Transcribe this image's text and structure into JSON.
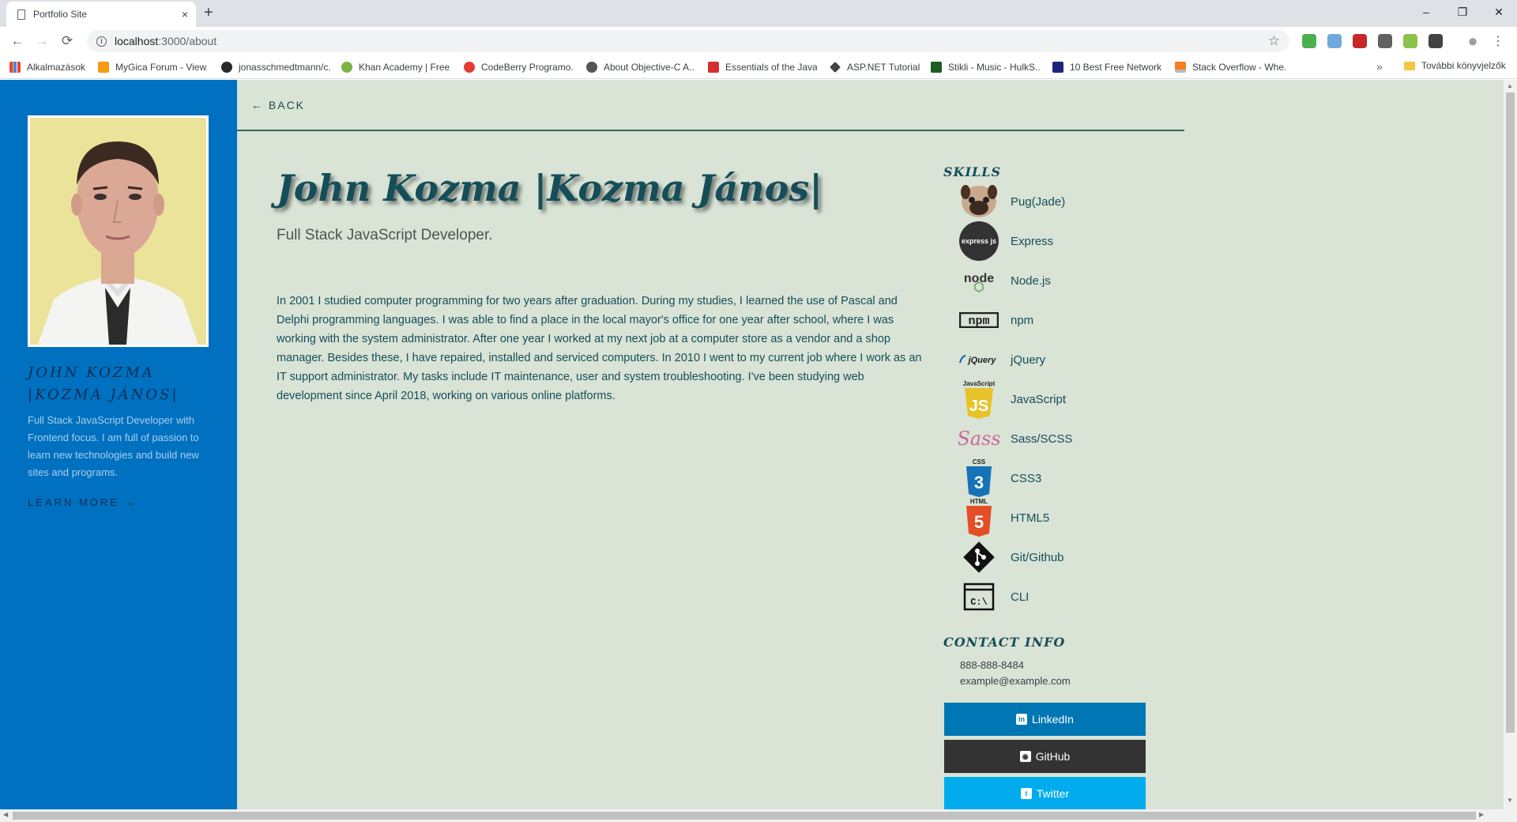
{
  "browser": {
    "tab_title": "Portfolio Site",
    "tab_close": "×",
    "new_tab": "+",
    "url_host": "localhost",
    "url_path": ":3000/about",
    "window_controls": [
      "–",
      "❐",
      "✕"
    ],
    "bookmarks": [
      "Alkalmazások",
      "MyGica Forum - View...",
      "jonasschmedtmann/c...",
      "Khan Academy | Free...",
      "CodeBerry Programo...",
      "About Objective-C A...",
      "Essentials of the Java...",
      "ASP.NET Tutorial",
      "Stikli - Music - HulkS...",
      "10 Best Free Network...",
      "Stack Overflow - Whe..."
    ],
    "bookmarks_more": "»",
    "other_bookmarks": "További könyvjelzők",
    "extension_colors": [
      "#4caf50",
      "#6fa8dc",
      "#c62828",
      "#616161",
      "#8bc34a",
      "#424242"
    ]
  },
  "sidebar": {
    "name": "JOHN KOZMA |KOZMA JÁNOS|",
    "description": "Full Stack JavaScript Developer with Frontend focus. I am full of passion to learn new technologies and build new sites and programs.",
    "learn_more": "LEARN MORE →"
  },
  "main": {
    "back": "← BACK",
    "heading": "John Kozma |Kozma János|",
    "subtitle": "Full Stack JavaScript Developer.",
    "bio": "In 2001 I studied computer programming for two years after graduation. During my studies, I learned the use of Pascal and Delphi programming languages. I was able to find a place in the local mayor's office for one year after school, where I was working with the system administrator. After one year I worked at my next job at a computer store as a vendor and a shop manager. Besides these, I have repaired, installed and serviced computers. In 2010 I went to my current job where I work as an IT support administrator. My tasks include IT maintenance, user and system troubleshooting. I've been studying web development since April 2018, working on various online platforms."
  },
  "skills": {
    "heading": "SKILLS",
    "items": [
      {
        "label": "Pug(Jade)",
        "icon": "pug-icon"
      },
      {
        "label": "Express",
        "icon": "express-icon"
      },
      {
        "label": "Node.js",
        "icon": "nodejs-icon"
      },
      {
        "label": "npm",
        "icon": "npm-icon"
      },
      {
        "label": "jQuery",
        "icon": "jquery-icon"
      },
      {
        "label": "JavaScript",
        "icon": "javascript-icon"
      },
      {
        "label": "Sass/SCSS",
        "icon": "sass-icon"
      },
      {
        "label": "CSS3",
        "icon": "css3-icon"
      },
      {
        "label": "HTML5",
        "icon": "html5-icon"
      },
      {
        "label": "Git/Github",
        "icon": "git-icon"
      },
      {
        "label": "CLI",
        "icon": "cli-icon"
      }
    ],
    "logo_text": {
      "express": "express js",
      "node": "node",
      "npm": "npm",
      "jquery": "jQuery",
      "js_top": "JavaScript",
      "js": "JS",
      "sass": "Sass",
      "css_top": "CSS",
      "css": "3",
      "html_top": "HTML",
      "html": "5",
      "cli": "C:\\"
    }
  },
  "contact": {
    "heading": "CONTACT INFO",
    "phone": "888-888-8484",
    "email": "example@example.com",
    "buttons": [
      {
        "label": "LinkedIn",
        "glyph": "in",
        "color": "#0077b5"
      },
      {
        "label": "GitHub",
        "glyph": "◉",
        "color": "#333333"
      },
      {
        "label": "Twitter",
        "glyph": "t",
        "color": "#00aced"
      }
    ]
  },
  "colors": {
    "sidebar": "#0070c0",
    "page_bg": "#d9e3d6",
    "accent_text": "#154e59"
  }
}
